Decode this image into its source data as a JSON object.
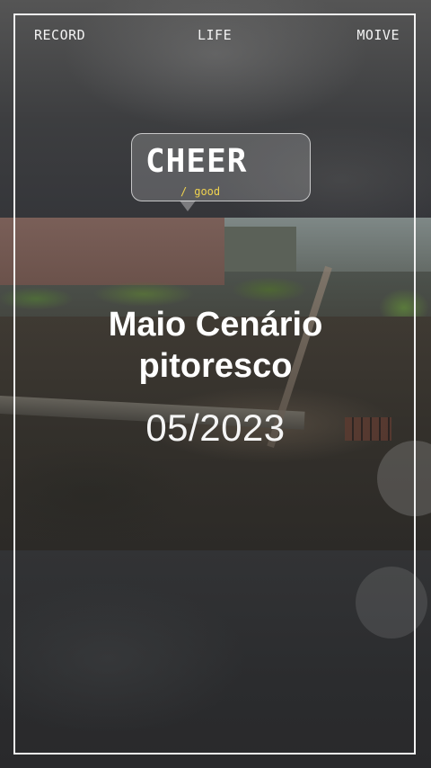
{
  "header": {
    "left_label": "RECORD",
    "center_label": "LIFE",
    "right_label": "MOIVE"
  },
  "bubble": {
    "title": "CHEER",
    "slash": "/",
    "subtitle": "good"
  },
  "caption": {
    "line1": "Maio Cenário",
    "line2": "pitoresco",
    "date": "05/2023"
  },
  "colors": {
    "frame": "#f2f2f2",
    "text": "#ffffff",
    "accent": "#f0d34f"
  }
}
